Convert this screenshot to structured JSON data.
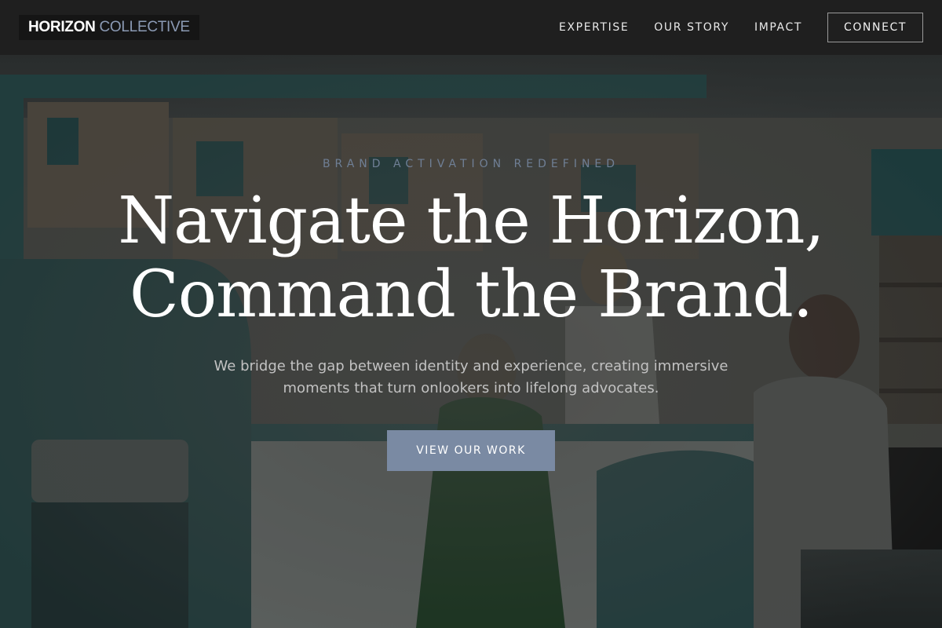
{
  "brand": {
    "name_primary": "HORIZON",
    "name_secondary": "COLLECTIVE"
  },
  "nav": {
    "links": [
      {
        "label": "EXPERTISE"
      },
      {
        "label": "OUR STORY"
      },
      {
        "label": "IMPACT"
      }
    ],
    "cta_label": "CONNECT"
  },
  "hero": {
    "eyebrow": "BRAND ACTIVATION REDEFINED",
    "headline_line1": "Navigate the Horizon,",
    "headline_line2": "Command the Brand.",
    "subtext": "We bridge the gap between identity and experience, creating immersive moments that turn onlookers into lifelong advocates.",
    "cta_label": "VIEW OUR WORK"
  },
  "colors": {
    "nav_background": "#1f1f1f",
    "accent": "#7a8aa3",
    "eyebrow": "#6f7f95",
    "headline": "#ffffff"
  }
}
